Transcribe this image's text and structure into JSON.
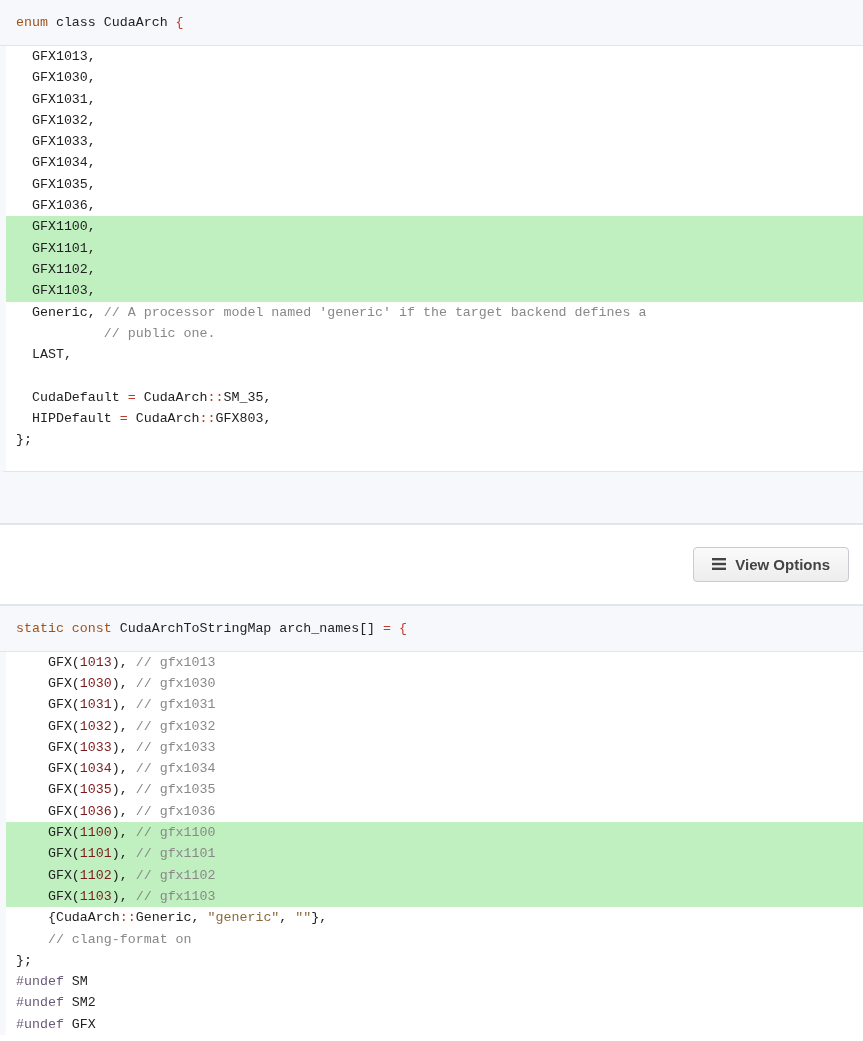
{
  "blocks": [
    {
      "header": [
        {
          "kind": "keyword",
          "text": "enum"
        },
        {
          "kind": "plain",
          "text": " class CudaArch "
        },
        {
          "kind": "op",
          "text": "{"
        }
      ],
      "lines": [
        {
          "added": false,
          "tokens": [
            {
              "kind": "plain",
              "text": "  GFX1013,"
            }
          ]
        },
        {
          "added": false,
          "tokens": [
            {
              "kind": "plain",
              "text": "  GFX1030,"
            }
          ]
        },
        {
          "added": false,
          "tokens": [
            {
              "kind": "plain",
              "text": "  GFX1031,"
            }
          ]
        },
        {
          "added": false,
          "tokens": [
            {
              "kind": "plain",
              "text": "  GFX1032,"
            }
          ]
        },
        {
          "added": false,
          "tokens": [
            {
              "kind": "plain",
              "text": "  GFX1033,"
            }
          ]
        },
        {
          "added": false,
          "tokens": [
            {
              "kind": "plain",
              "text": "  GFX1034,"
            }
          ]
        },
        {
          "added": false,
          "tokens": [
            {
              "kind": "plain",
              "text": "  GFX1035,"
            }
          ]
        },
        {
          "added": false,
          "tokens": [
            {
              "kind": "plain",
              "text": "  GFX1036,"
            }
          ]
        },
        {
          "added": true,
          "tokens": [
            {
              "kind": "plain",
              "text": "  GFX1100,"
            }
          ]
        },
        {
          "added": true,
          "tokens": [
            {
              "kind": "plain",
              "text": "  GFX1101,"
            }
          ]
        },
        {
          "added": true,
          "tokens": [
            {
              "kind": "plain",
              "text": "  GFX1102,"
            }
          ]
        },
        {
          "added": true,
          "tokens": [
            {
              "kind": "plain",
              "text": "  GFX1103,"
            }
          ]
        },
        {
          "added": false,
          "tokens": [
            {
              "kind": "plain",
              "text": "  Generic, "
            },
            {
              "kind": "comment",
              "text": "// A processor model named 'generic' if the target backend defines a"
            }
          ]
        },
        {
          "added": false,
          "tokens": [
            {
              "kind": "comment",
              "text": "           // public one."
            }
          ]
        },
        {
          "added": false,
          "tokens": [
            {
              "kind": "plain",
              "text": "  LAST,"
            }
          ]
        },
        {
          "added": false
        },
        {
          "added": false,
          "tokens": [
            {
              "kind": "plain",
              "text": "  CudaDefault "
            },
            {
              "kind": "op",
              "text": "="
            },
            {
              "kind": "plain",
              "text": " CudaArch"
            },
            {
              "kind": "op",
              "text": "::"
            },
            {
              "kind": "plain",
              "text": "SM_35,"
            }
          ]
        },
        {
          "added": false,
          "tokens": [
            {
              "kind": "plain",
              "text": "  HIPDefault "
            },
            {
              "kind": "op",
              "text": "="
            },
            {
              "kind": "plain",
              "text": " CudaArch"
            },
            {
              "kind": "op",
              "text": "::"
            },
            {
              "kind": "plain",
              "text": "GFX803,"
            }
          ]
        },
        {
          "added": false,
          "tokens": [
            {
              "kind": "plain",
              "text": "};"
            }
          ]
        }
      ]
    },
    {
      "header": [
        {
          "kind": "keyword",
          "text": "static const"
        },
        {
          "kind": "plain",
          "text": " CudaArchToStringMap arch_names[] "
        },
        {
          "kind": "op",
          "text": "="
        },
        {
          "kind": "op",
          "text": " {"
        }
      ],
      "lines": [
        {
          "added": false,
          "tokens": [
            {
              "kind": "plain",
              "text": "    GFX("
            },
            {
              "kind": "number",
              "text": "1013"
            },
            {
              "kind": "plain",
              "text": "), "
            },
            {
              "kind": "comment",
              "text": "// gfx1013"
            }
          ]
        },
        {
          "added": false,
          "tokens": [
            {
              "kind": "plain",
              "text": "    GFX("
            },
            {
              "kind": "number",
              "text": "1030"
            },
            {
              "kind": "plain",
              "text": "), "
            },
            {
              "kind": "comment",
              "text": "// gfx1030"
            }
          ]
        },
        {
          "added": false,
          "tokens": [
            {
              "kind": "plain",
              "text": "    GFX("
            },
            {
              "kind": "number",
              "text": "1031"
            },
            {
              "kind": "plain",
              "text": "), "
            },
            {
              "kind": "comment",
              "text": "// gfx1031"
            }
          ]
        },
        {
          "added": false,
          "tokens": [
            {
              "kind": "plain",
              "text": "    GFX("
            },
            {
              "kind": "number",
              "text": "1032"
            },
            {
              "kind": "plain",
              "text": "), "
            },
            {
              "kind": "comment",
              "text": "// gfx1032"
            }
          ]
        },
        {
          "added": false,
          "tokens": [
            {
              "kind": "plain",
              "text": "    GFX("
            },
            {
              "kind": "number",
              "text": "1033"
            },
            {
              "kind": "plain",
              "text": "), "
            },
            {
              "kind": "comment",
              "text": "// gfx1033"
            }
          ]
        },
        {
          "added": false,
          "tokens": [
            {
              "kind": "plain",
              "text": "    GFX("
            },
            {
              "kind": "number",
              "text": "1034"
            },
            {
              "kind": "plain",
              "text": "), "
            },
            {
              "kind": "comment",
              "text": "// gfx1034"
            }
          ]
        },
        {
          "added": false,
          "tokens": [
            {
              "kind": "plain",
              "text": "    GFX("
            },
            {
              "kind": "number",
              "text": "1035"
            },
            {
              "kind": "plain",
              "text": "), "
            },
            {
              "kind": "comment",
              "text": "// gfx1035"
            }
          ]
        },
        {
          "added": false,
          "tokens": [
            {
              "kind": "plain",
              "text": "    GFX("
            },
            {
              "kind": "number",
              "text": "1036"
            },
            {
              "kind": "plain",
              "text": "), "
            },
            {
              "kind": "comment",
              "text": "// gfx1036"
            }
          ]
        },
        {
          "added": true,
          "tokens": [
            {
              "kind": "plain",
              "text": "    GFX("
            },
            {
              "kind": "number",
              "text": "1100"
            },
            {
              "kind": "plain",
              "text": "), "
            },
            {
              "kind": "comment",
              "text": "// gfx1100"
            }
          ]
        },
        {
          "added": true,
          "tokens": [
            {
              "kind": "plain",
              "text": "    GFX("
            },
            {
              "kind": "number",
              "text": "1101"
            },
            {
              "kind": "plain",
              "text": "), "
            },
            {
              "kind": "comment",
              "text": "// gfx1101"
            }
          ]
        },
        {
          "added": true,
          "tokens": [
            {
              "kind": "plain",
              "text": "    GFX("
            },
            {
              "kind": "number",
              "text": "1102"
            },
            {
              "kind": "plain",
              "text": "), "
            },
            {
              "kind": "comment",
              "text": "// gfx1102"
            }
          ]
        },
        {
          "added": true,
          "tokens": [
            {
              "kind": "plain",
              "text": "    GFX("
            },
            {
              "kind": "number",
              "text": "1103"
            },
            {
              "kind": "plain",
              "text": "), "
            },
            {
              "kind": "comment",
              "text": "// gfx1103"
            }
          ]
        },
        {
          "added": false,
          "tokens": [
            {
              "kind": "plain",
              "text": "    {CudaArch"
            },
            {
              "kind": "op",
              "text": "::"
            },
            {
              "kind": "plain",
              "text": "Generic, "
            },
            {
              "kind": "string",
              "text": "\"generic\""
            },
            {
              "kind": "plain",
              "text": ", "
            },
            {
              "kind": "string",
              "text": "\"\""
            },
            {
              "kind": "plain",
              "text": "},"
            }
          ]
        },
        {
          "added": false,
          "tokens": [
            {
              "kind": "comment",
              "text": "    // clang-format on"
            }
          ]
        },
        {
          "added": false,
          "tokens": [
            {
              "kind": "plain",
              "text": "};"
            }
          ]
        },
        {
          "added": false,
          "tokens": [
            {
              "kind": "preproc",
              "text": "#undef"
            },
            {
              "kind": "plain",
              "text": " SM"
            }
          ]
        },
        {
          "added": false,
          "tokens": [
            {
              "kind": "preproc",
              "text": "#undef"
            },
            {
              "kind": "plain",
              "text": " SM2"
            }
          ]
        },
        {
          "added": false,
          "tokens": [
            {
              "kind": "preproc",
              "text": "#undef"
            },
            {
              "kind": "plain",
              "text": " GFX"
            }
          ]
        }
      ]
    }
  ],
  "toolbar": {
    "button": "View Options"
  }
}
